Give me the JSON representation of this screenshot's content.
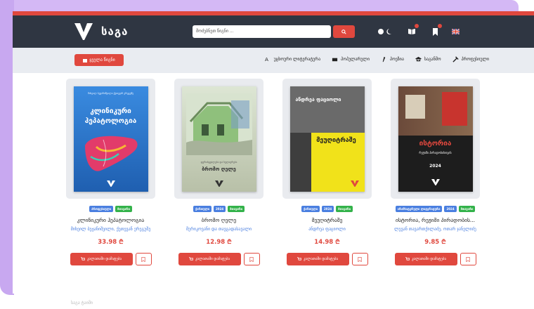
{
  "site": {
    "brand": "საგა",
    "accent_color": "#e0483e",
    "header_color": "#2f3642"
  },
  "header": {
    "search_placeholder": "მოძებნეთ წიგნი ...",
    "search_icon": "search-icon",
    "theme_icon": "sun-moon-icon",
    "books_icon": "open-book-icon",
    "bookmark_icon": "bookmark-icon",
    "language_flag": "uk-flag-icon"
  },
  "navbar": {
    "primary_button": "ყველა წიგნი",
    "items": [
      {
        "label": "უცხოური ლიტერატურა",
        "icon": "translate-icon"
      },
      {
        "label": "პოპულარული",
        "icon": "books-icon"
      },
      {
        "label": "პოეზია",
        "icon": "pen-icon"
      },
      {
        "label": "საგანმო",
        "icon": "graduation-icon"
      },
      {
        "label": "პროფესიული",
        "icon": "tools-icon"
      }
    ]
  },
  "books": [
    {
      "tags": [
        {
          "label": "პროფესიული",
          "color": "blue"
        },
        {
          "label": "მთავარი",
          "color": "green"
        }
      ],
      "title": "კლინიკური ჰეპატოლოგია",
      "author": "მიხეილ ბეჟანიშვილი, ქეთევან ერეგუშე",
      "price": "33.98 ₾",
      "cart_label": "კალათაში დამატება",
      "cover": {
        "top_authors": "მიხეილ ბეჟანიშვილი   ქეთევან ერეგუშე",
        "line1": "კლინიკური",
        "line2": "ჰეპატოლოგია",
        "bg": "#2a73c9"
      }
    },
    {
      "tags": [
        {
          "label": "ქართული",
          "color": "blue"
        },
        {
          "label": "2024",
          "color": "blue"
        },
        {
          "label": "მთავარი",
          "color": "green"
        }
      ],
      "title": "ბრომო ღელე",
      "author": "მერიკოვანი და თავგადასავალი",
      "price": "12.98 ₾",
      "cart_label": "კალათაში დამატება",
      "cover": {
        "subtitle": "ფერისცვალება და სულიერება",
        "line1": "ბრომო ღელე",
        "bg": "#c7c9b2"
      }
    },
    {
      "tags": [
        {
          "label": "ქართული",
          "color": "blue"
        },
        {
          "label": "2024",
          "color": "blue"
        },
        {
          "label": "მთავარი",
          "color": "green"
        }
      ],
      "title": "მეუღიტრაშე",
      "author": "ანდრეა ფაციოლი",
      "price": "14.98 ₾",
      "cart_label": "კალათაში დამატება",
      "cover": {
        "author_top": "ანდრეა ფაციოლი",
        "line1": "მეუღიტრაშე",
        "bg": "#f1e21a"
      }
    },
    {
      "tags": [
        {
          "label": "არამხატვრული ლიტერატურა",
          "color": "blue"
        },
        {
          "label": "2024",
          "color": "blue"
        },
        {
          "label": "მთავარი",
          "color": "green"
        }
      ],
      "title": "ისტორია, რეჟიმი პირადობის...",
      "author": "ლევან თავართქილაძე, ოთარ ჯანელიძე",
      "price": "9.85 ₾",
      "cart_label": "კალათაში დამატება",
      "cover": {
        "line1": "ისტორია",
        "subtitle": "რეჟიმი პირადობისთვის",
        "year": "2024",
        "bg": "#1d1d1d"
      }
    }
  ],
  "footer_fragment": "საგა ტაიმი"
}
